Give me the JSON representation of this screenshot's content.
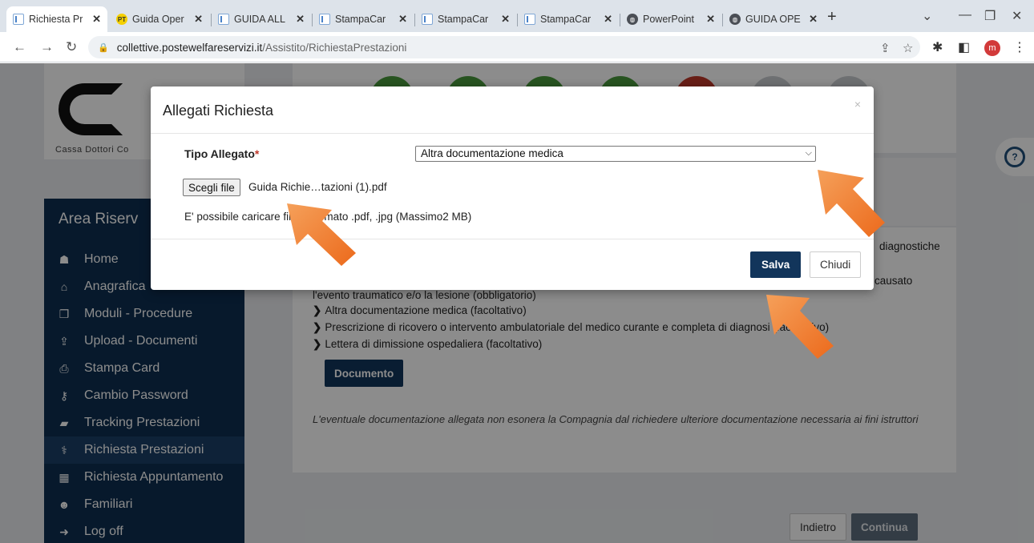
{
  "browser": {
    "tabs": [
      {
        "label": "Richiesta Pr",
        "icon": "doc",
        "active": true
      },
      {
        "label": "Guida Oper",
        "icon": "pt",
        "active": false
      },
      {
        "label": "GUIDA ALL",
        "icon": "doc",
        "active": false
      },
      {
        "label": "StampaCar",
        "icon": "doc",
        "active": false
      },
      {
        "label": "StampaCar",
        "icon": "doc",
        "active": false
      },
      {
        "label": "StampaCar",
        "icon": "doc",
        "active": false
      },
      {
        "label": "PowerPoint",
        "icon": "globe",
        "active": false
      },
      {
        "label": "GUIDA OPE",
        "icon": "globe",
        "active": false
      }
    ],
    "url_host": "collettive.postewelfareservizi.it",
    "url_path": "/Assistito/RichiestaPrestazioni",
    "profile_initial": "m"
  },
  "page": {
    "logo_text": "Cassa Dottori Co",
    "sidebar": {
      "title": "Area Riserv",
      "items": [
        {
          "label": "Home",
          "icon": "home-icon",
          "glyph": "☗"
        },
        {
          "label": "Anagrafica",
          "icon": "bank-icon",
          "glyph": "⌂"
        },
        {
          "label": "Moduli - Procedure",
          "icon": "copy-icon",
          "glyph": "❐"
        },
        {
          "label": "Upload - Documenti",
          "icon": "upload-icon",
          "glyph": "⇪"
        },
        {
          "label": "Stampa Card",
          "icon": "print-icon",
          "glyph": "⎙"
        },
        {
          "label": "Cambio Password",
          "icon": "key-icon",
          "glyph": "⚷"
        },
        {
          "label": "Tracking Prestazioni",
          "icon": "book-icon",
          "glyph": "▰"
        },
        {
          "label": "Richiesta Prestazioni",
          "icon": "stethoscope-icon",
          "glyph": "⚕"
        },
        {
          "label": "Richiesta Appuntamento",
          "icon": "calendar-icon",
          "glyph": "▦"
        },
        {
          "label": "Familiari",
          "icon": "users-icon",
          "glyph": "☻"
        },
        {
          "label": "Log off",
          "icon": "logoff-icon",
          "glyph": "➜"
        }
      ]
    },
    "content": {
      "side_text_1": "diagnostiche",
      "side_text_2": "causato",
      "line_1": "l'evento traumatico e/o la lesione (obbligatorio)",
      "bullets": [
        "Altra documentazione medica (facoltativo)",
        "Prescrizione di ricovero o intervento ambulatoriale del medico curante e completa di diagnosi (facoltativo)",
        "Lettera di dimissione ospedaliera (facoltativo)"
      ],
      "document_button": "Documento",
      "note": "L'eventuale documentazione allegata non esonera la Compagnia dal richiedere ulteriore documentazione necessaria ai fini istruttori"
    },
    "buttons": {
      "back": "Indietro",
      "next": "Continua"
    }
  },
  "modal": {
    "title": "Allegati Richiesta",
    "close_symbol": "×",
    "field_label": "Tipo Allegato",
    "required_mark": "*",
    "select_value": "Altra documentazione medica",
    "file_button": "Scegli file",
    "file_name": "Guida Richie…tazioni (1).pdf",
    "help_text": "E' possibile caricare file in formato .pdf, .jpg (Massimo2 MB)",
    "save": "Salva",
    "close": "Chiudi"
  },
  "colors": {
    "primary": "#12355b",
    "sidebar": "#0d2f51",
    "arrow": "#f07a2a",
    "required": "#c0392b"
  }
}
